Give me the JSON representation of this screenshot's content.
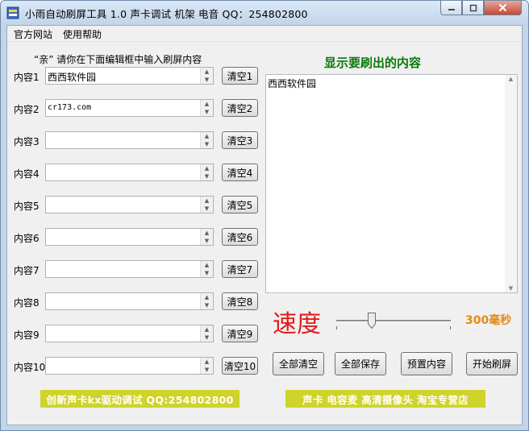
{
  "window": {
    "title": "小雨自动刷屏工具 1.0  声卡调试 机架 电音 QQ：254802800",
    "controls": [
      "minimize",
      "maximize",
      "close"
    ]
  },
  "menu": [
    "官方网站",
    "使用帮助"
  ],
  "hint": "“亲”  请你在下面编辑框中输入刷屏内容",
  "rows": [
    {
      "label": "内容1",
      "value": "西西软件园",
      "clear": "清空1"
    },
    {
      "label": "内容2",
      "value": "cr173.com",
      "clear": "清空2"
    },
    {
      "label": "内容3",
      "value": "",
      "clear": "清空3"
    },
    {
      "label": "内容4",
      "value": "",
      "clear": "清空4"
    },
    {
      "label": "内容5",
      "value": "",
      "clear": "清空5"
    },
    {
      "label": "内容6",
      "value": "",
      "clear": "清空6"
    },
    {
      "label": "内容7",
      "value": "",
      "clear": "清空7"
    },
    {
      "label": "内容8",
      "value": "",
      "clear": "清空8"
    },
    {
      "label": "内容9",
      "value": "",
      "clear": "清空9"
    },
    {
      "label": "内容10",
      "value": "",
      "clear": "清空10"
    }
  ],
  "preview": {
    "title": "显示要刷出的内容",
    "text": "西西软件园"
  },
  "speed": {
    "label": "速度",
    "value_text": "300毫秒",
    "slider_position": 0.31
  },
  "actions": [
    "全部清空",
    "全部保存",
    "预置内容",
    "开始刷屏"
  ],
  "banners": [
    "创新声卡kx驱动调试 QQ:254802800",
    "声卡 电容麦 高清摄像头 淘宝专营店"
  ],
  "colors": {
    "preview_title": "#0a7a0a",
    "speed_label": "#e31a1a",
    "speed_value": "#e48a1a",
    "banner_bg": "#cfd32a",
    "banner_text": "#ffffff"
  }
}
